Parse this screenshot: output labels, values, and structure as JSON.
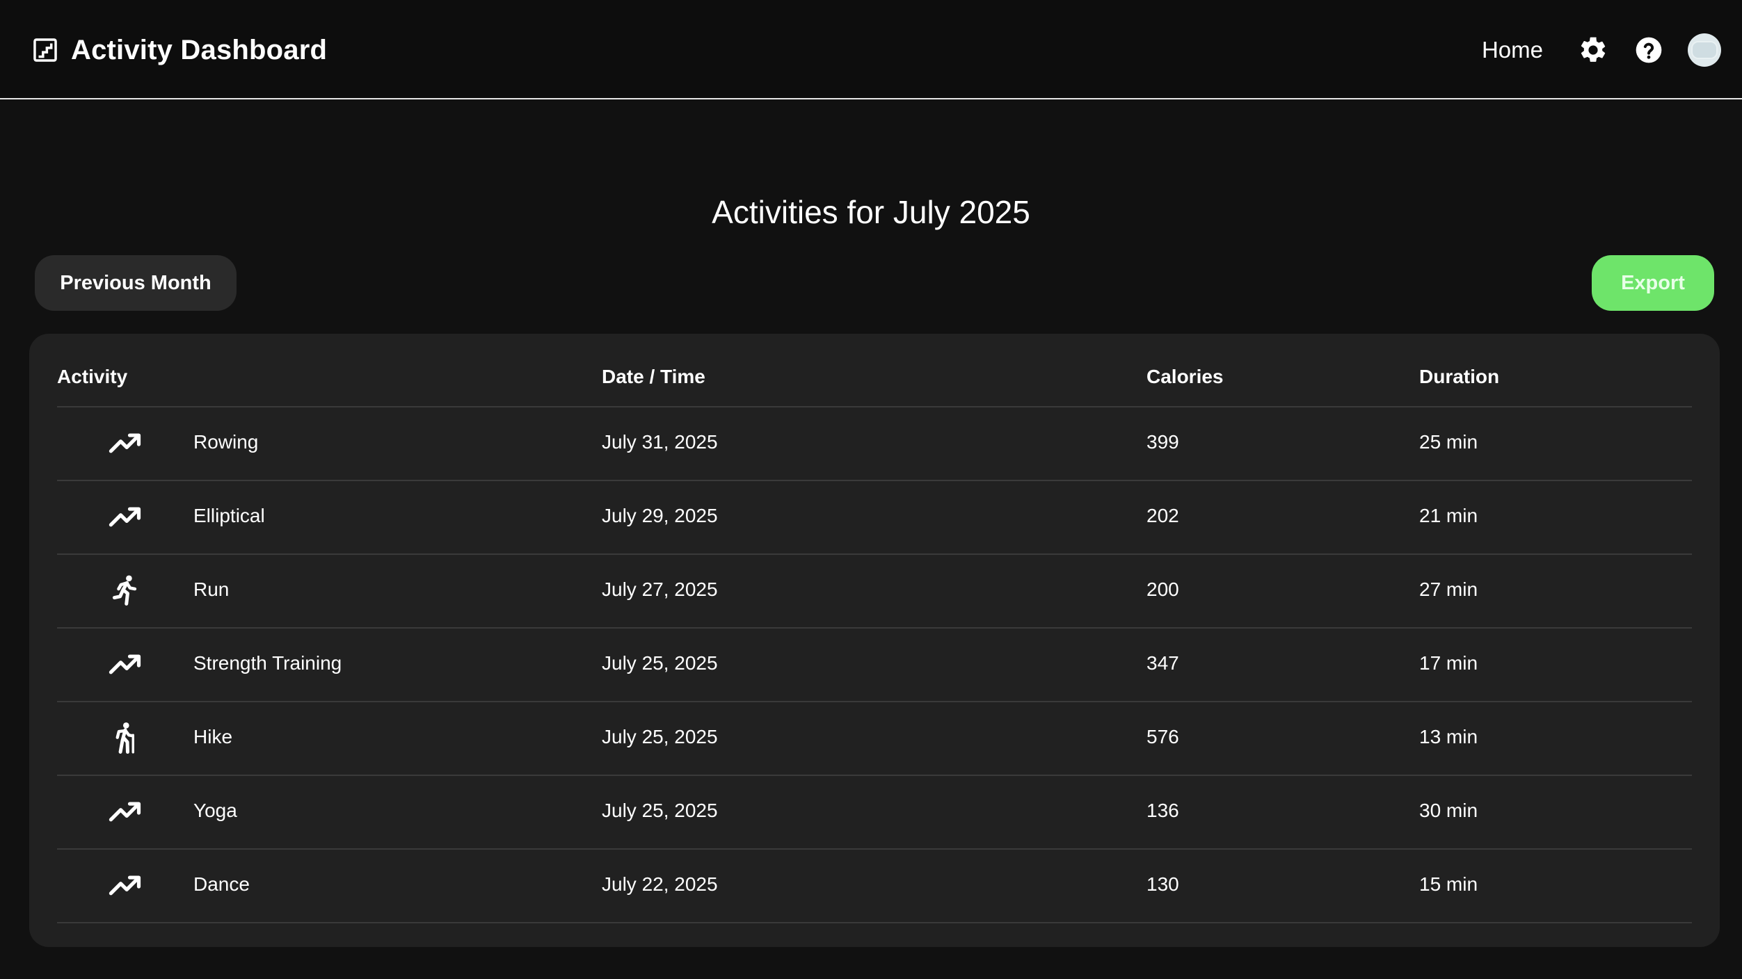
{
  "header": {
    "title": "Activity Dashboard",
    "logo_icon": "stairs-icon",
    "nav": {
      "home_label": "Home",
      "settings_icon": "gear-icon",
      "help_icon": "help-icon",
      "avatar_icon": "avatar"
    }
  },
  "main": {
    "title": "Activities for July 2025",
    "previous_label": "Previous Month",
    "export_label": "Export",
    "export_color": "#6ee46a"
  },
  "table": {
    "columns": [
      "Activity",
      "Date / Time",
      "Calories",
      "Duration"
    ],
    "rows": [
      {
        "icon": "trending-up-icon",
        "activity": "Rowing",
        "date": "July 31, 2025",
        "calories": "399",
        "duration": "25 min"
      },
      {
        "icon": "trending-up-icon",
        "activity": "Elliptical",
        "date": "July 29, 2025",
        "calories": "202",
        "duration": "21 min"
      },
      {
        "icon": "run-icon",
        "activity": "Run",
        "date": "July 27, 2025",
        "calories": "200",
        "duration": "27 min"
      },
      {
        "icon": "trending-up-icon",
        "activity": "Strength Training",
        "date": "July 25, 2025",
        "calories": "347",
        "duration": "17 min"
      },
      {
        "icon": "hike-icon",
        "activity": "Hike",
        "date": "July 25, 2025",
        "calories": "576",
        "duration": "13 min"
      },
      {
        "icon": "trending-up-icon",
        "activity": "Yoga",
        "date": "July 25, 2025",
        "calories": "136",
        "duration": "30 min"
      },
      {
        "icon": "trending-up-icon",
        "activity": "Dance",
        "date": "July 22, 2025",
        "calories": "130",
        "duration": "15 min"
      }
    ]
  }
}
